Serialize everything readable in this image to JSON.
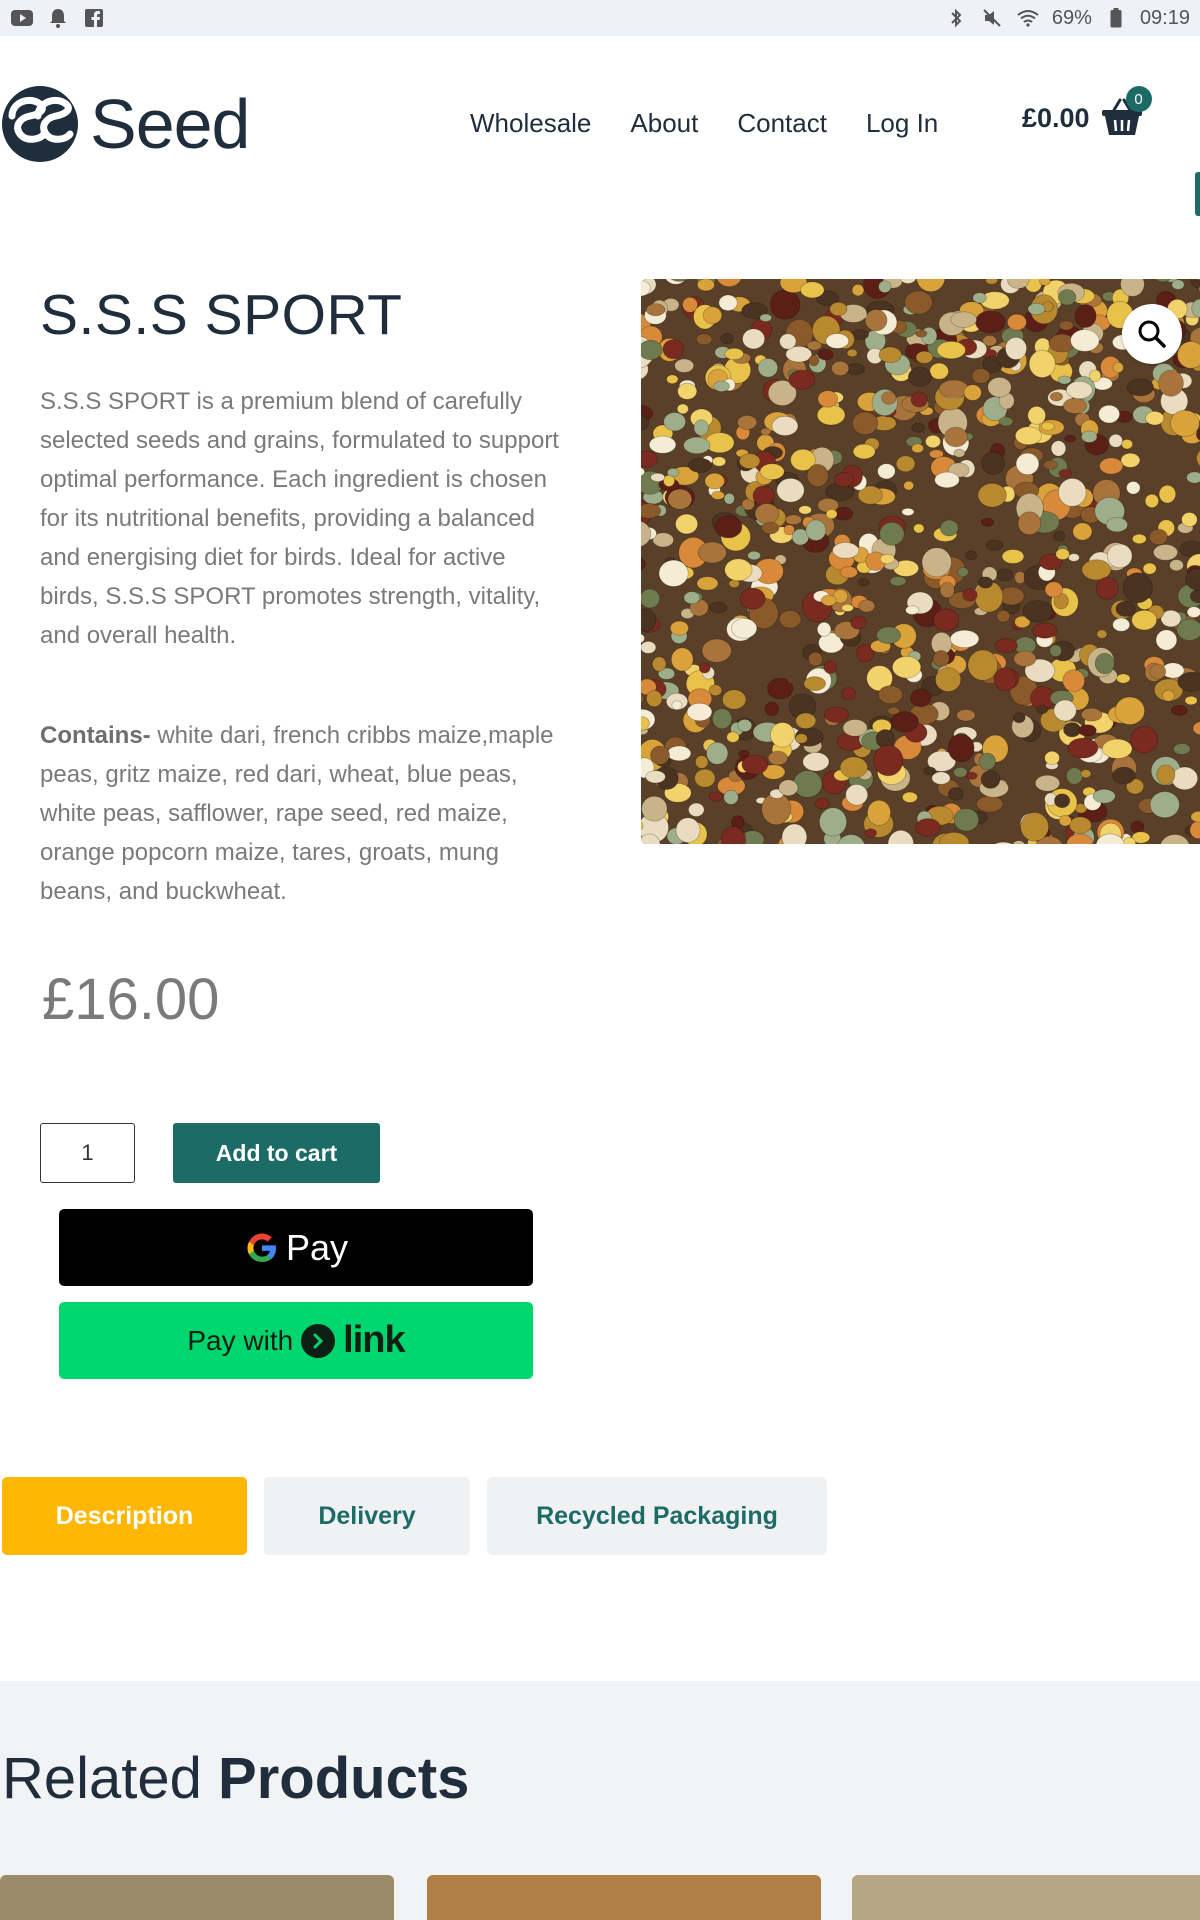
{
  "status_bar": {
    "battery": "69%",
    "time": "09:19"
  },
  "header": {
    "logo_text": "Seed",
    "nav": [
      "Wholesale",
      "About",
      "Contact",
      "Log In"
    ],
    "cart_total": "£0.00",
    "cart_count": "0"
  },
  "product": {
    "title": "S.S.S SPORT",
    "description": "S.S.S SPORT is a premium blend of carefully selected seeds and grains, formulated to support optimal performance. Each ingredient is chosen for its nutritional benefits, providing a balanced and energising diet for birds. Ideal for active birds, S.S.S SPORT promotes strength, vitality, and overall health.",
    "contains_label": "Contains-",
    "contains_text": " white dari, french cribbs maize,maple peas, gritz maize, red dari, wheat, blue peas, white peas, safflower, rape seed, red maize, orange popcorn maize, tares, groats, mung beans, and buckwheat.",
    "price": "£16.00",
    "quantity": "1",
    "add_to_cart_label": "Add to cart",
    "gpay_label": "Pay",
    "link_pay_prefix": "Pay with",
    "link_pay_brand": "link"
  },
  "tabs": [
    "Description",
    "Delivery",
    "Recycled Packaging"
  ],
  "related": {
    "title_light": "Related",
    "title_bold": "Products"
  },
  "colors": {
    "accent": "#1d6b66",
    "tab_active": "#ffb703",
    "link_green": "#00d66f",
    "text_dark": "#1f2d3d"
  }
}
